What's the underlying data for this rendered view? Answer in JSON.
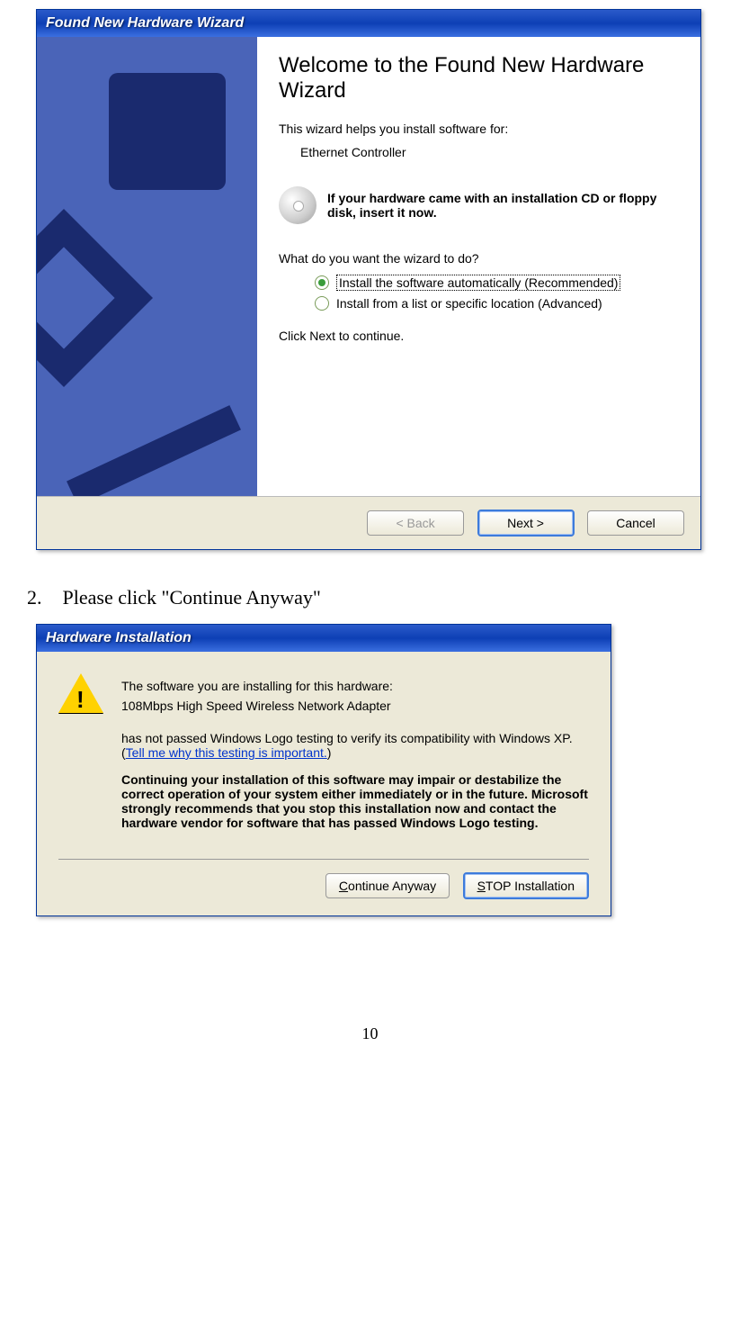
{
  "wizard1": {
    "title": "Found New Hardware Wizard",
    "heading": "Welcome to the Found New Hardware Wizard",
    "intro": "This wizard helps you install software for:",
    "device": "Ethernet Controller",
    "cd_prompt": "If your hardware came with an installation CD or floppy disk, insert it now.",
    "question": "What do you want the wizard to do?",
    "option1": "Install the software automatically (Recommended)",
    "option2": "Install from a list or specific location (Advanced)",
    "continue_text": "Click Next to continue.",
    "back": "< Back",
    "next": "Next >",
    "cancel": "Cancel"
  },
  "step2": {
    "num": "2.",
    "text": "Please click \"Continue Anyway\""
  },
  "wizard2": {
    "title": "Hardware Installation",
    "line1": "The software you are installing for this hardware:",
    "device": "108Mbps High Speed Wireless Network Adapter",
    "line2a": "has not passed Windows Logo testing to verify its compatibility with Windows XP. (",
    "link": "Tell me why this testing is important.",
    "line2b": ")",
    "warning": "Continuing your installation of this software may impair or destabilize the correct operation of your system either immediately or in the future. Microsoft strongly recommends that you stop this installation now and contact the hardware vendor for software that has passed Windows Logo testing.",
    "continue": "Continue Anyway",
    "stop": "STOP Installation"
  },
  "page_number": "10"
}
